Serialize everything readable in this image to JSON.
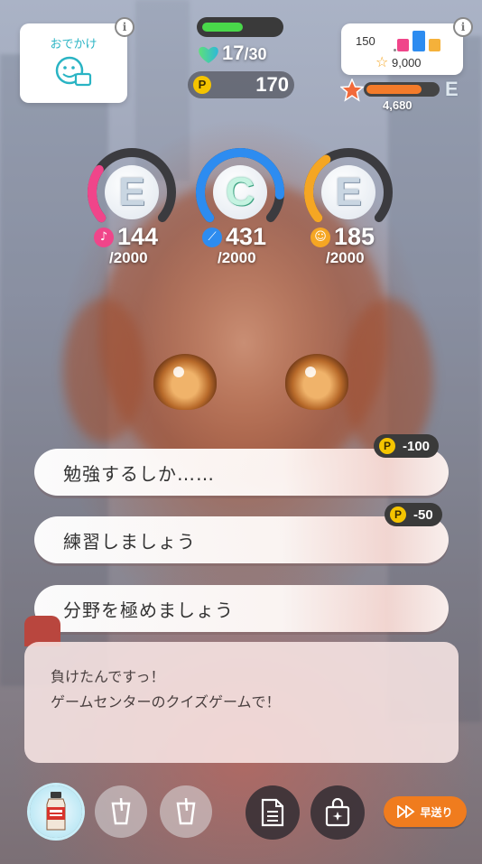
{
  "outing": {
    "label": "おでかけ",
    "icon": "outing-face-icon"
  },
  "stamina": {
    "current": "17",
    "max": "/30",
    "fill_fraction": 0.53,
    "color": "#49d84a"
  },
  "points": {
    "value": "170"
  },
  "rank_card": {
    "top_value": "150",
    "star_value": "9,000"
  },
  "fan_rank": {
    "grade": "E",
    "value": "4,680",
    "fill_fraction": 0.78
  },
  "stats": [
    {
      "name": "vocal",
      "grade": "E",
      "value": "144",
      "max": "/2000",
      "color": "#f0458a",
      "icon": "microphone-icon"
    },
    {
      "name": "dance",
      "grade": "C",
      "value": "431",
      "max": "/2000",
      "color": "#2d8cf0",
      "icon": "shoe-icon"
    },
    {
      "name": "visual",
      "grade": "E",
      "value": "185",
      "max": "/2000",
      "color": "#f5a623",
      "icon": "face-icon"
    }
  ],
  "choices": [
    {
      "label": "勉強するしか……",
      "cost": "-100"
    },
    {
      "label": "練習しましょう",
      "cost": "-50"
    },
    {
      "label": "分野を極めましょう",
      "cost": ""
    }
  ],
  "dialog": {
    "lines": [
      "負けたんですっ！",
      "ゲームセンターのクイズゲームで！"
    ]
  },
  "bottom_bar": {
    "fast_forward_label": "早送り",
    "coin_symbol": "P"
  }
}
